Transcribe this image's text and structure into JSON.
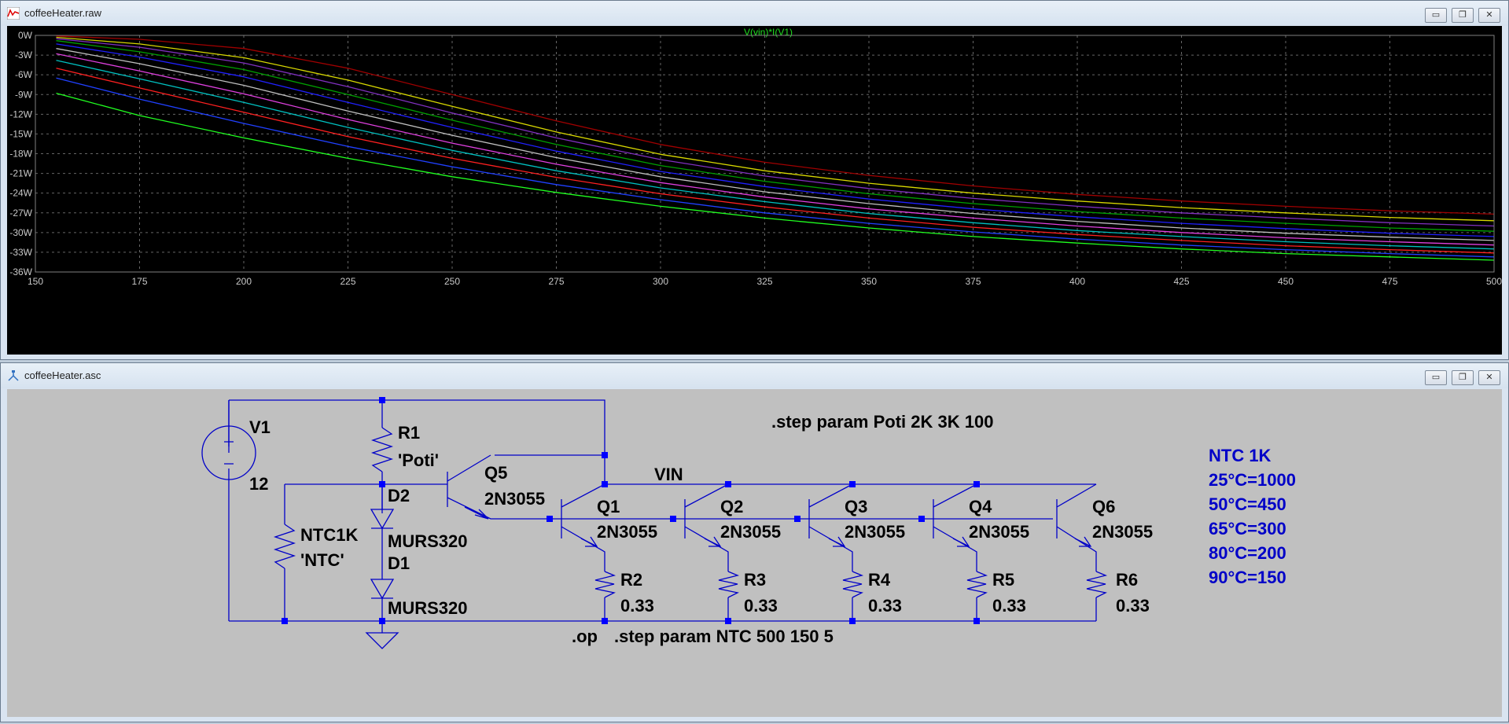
{
  "plot_window": {
    "title": "coffeeHeater.raw",
    "trace_label": "V(vin)*I(V1)",
    "minimize_glyph": "▭",
    "restore_glyph": "❐",
    "close_glyph": "✕"
  },
  "schematic_window": {
    "title": "coffeeHeater.asc",
    "minimize_glyph": "▭",
    "restore_glyph": "❐",
    "close_glyph": "✕"
  },
  "chart_data": {
    "type": "line",
    "title": "V(vin)*I(V1)",
    "xlabel": "",
    "ylabel": "",
    "xlim": [
      150,
      500
    ],
    "ylim": [
      -36,
      0
    ],
    "x_ticks": [
      "150",
      "175",
      "200",
      "225",
      "250",
      "275",
      "300",
      "325",
      "350",
      "375",
      "400",
      "425",
      "450",
      "475",
      "500"
    ],
    "y_ticks": [
      "0W",
      "-3W",
      "-6W",
      "-9W",
      "-12W",
      "-15W",
      "-18W",
      "-21W",
      "-24W",
      "-27W",
      "-30W",
      "-33W",
      "-36W"
    ],
    "grid": true,
    "x": [
      155,
      175,
      200,
      225,
      250,
      275,
      300,
      325,
      350,
      375,
      400,
      425,
      450,
      475,
      500
    ],
    "series": [
      {
        "color": "#a00000",
        "values": [
          -0.1,
          -0.6,
          -2.0,
          -5.0,
          -9.0,
          -13.0,
          -16.6,
          -19.3,
          -21.3,
          -22.9,
          -24.2,
          -25.2,
          -26.0,
          -26.7,
          -27.2
        ]
      },
      {
        "color": "#d8d800",
        "values": [
          -0.3,
          -1.3,
          -3.4,
          -6.8,
          -10.8,
          -14.7,
          -18.1,
          -20.6,
          -22.5,
          -24.0,
          -25.2,
          -26.2,
          -27.0,
          -27.7,
          -28.2
        ]
      },
      {
        "color": "#8030c0",
        "values": [
          -0.5,
          -1.8,
          -4.2,
          -7.8,
          -11.8,
          -15.6,
          -18.9,
          -21.4,
          -23.3,
          -24.8,
          -26.0,
          -27.0,
          -27.8,
          -28.5,
          -29.0
        ]
      },
      {
        "color": "#00a000",
        "values": [
          -0.8,
          -2.5,
          -5.2,
          -9.0,
          -12.9,
          -16.6,
          -19.8,
          -22.2,
          -24.1,
          -25.6,
          -26.8,
          -27.8,
          -28.6,
          -29.3,
          -29.8
        ]
      },
      {
        "color": "#2020ff",
        "values": [
          -1.3,
          -3.3,
          -6.3,
          -10.2,
          -14.0,
          -17.6,
          -20.7,
          -23.0,
          -24.9,
          -26.4,
          -27.6,
          -28.6,
          -29.4,
          -30.1,
          -30.6
        ]
      },
      {
        "color": "#c0c0c0",
        "values": [
          -2.0,
          -4.3,
          -7.6,
          -11.5,
          -15.2,
          -18.6,
          -21.5,
          -23.8,
          -25.6,
          -27.1,
          -28.3,
          -29.3,
          -30.1,
          -30.7,
          -31.2
        ]
      },
      {
        "color": "#e040e0",
        "values": [
          -2.8,
          -5.4,
          -8.9,
          -12.8,
          -16.4,
          -19.6,
          -22.4,
          -24.6,
          -26.4,
          -27.8,
          -29.0,
          -30.0,
          -30.8,
          -31.4,
          -31.9
        ]
      },
      {
        "color": "#00c0c0",
        "values": [
          -3.8,
          -6.6,
          -10.2,
          -14.0,
          -17.5,
          -20.6,
          -23.2,
          -25.3,
          -27.1,
          -28.5,
          -29.7,
          -30.6,
          -31.4,
          -32.0,
          -32.5
        ]
      },
      {
        "color": "#ff2020",
        "values": [
          -5.0,
          -8.0,
          -11.7,
          -15.4,
          -18.7,
          -21.6,
          -24.1,
          -26.1,
          -27.8,
          -29.2,
          -30.3,
          -31.2,
          -32.0,
          -32.6,
          -33.1
        ]
      },
      {
        "color": "#2040ff",
        "values": [
          -6.5,
          -9.7,
          -13.4,
          -16.9,
          -20.0,
          -22.7,
          -25.0,
          -27.0,
          -28.6,
          -29.9,
          -31.0,
          -31.9,
          -32.6,
          -33.2,
          -33.7
        ]
      },
      {
        "color": "#20ff20",
        "values": [
          -8.8,
          -12.2,
          -15.6,
          -18.7,
          -21.5,
          -23.9,
          -26.0,
          -27.8,
          -29.3,
          -30.6,
          -31.6,
          -32.5,
          -33.2,
          -33.7,
          -34.2
        ]
      }
    ]
  },
  "schematic": {
    "labels": {
      "v1": "V1",
      "v1_value": "12",
      "r1": "R1",
      "r1_value": "'Poti'",
      "q5": "Q5",
      "q5_model": "2N3055",
      "d2": "D2",
      "d2_model": "MURS320",
      "d1": "D1",
      "d1_model": "MURS320",
      "ntc": "NTC1K",
      "ntc_value": "'NTC'",
      "vin": "VIN",
      "q1": "Q1",
      "q1_model": "2N3055",
      "q2": "Q2",
      "q2_model": "2N3055",
      "q3": "Q3",
      "q3_model": "2N3055",
      "q4": "Q4",
      "q4_model": "2N3055",
      "q6": "Q6",
      "q6_model": "2N3055",
      "r2": "R2",
      "r2_value": "0.33",
      "r3": "R3",
      "r3_value": "0.33",
      "r4": "R4",
      "r4_value": "0.33",
      "r5": "R5",
      "r5_value": "0.33",
      "r6": "R6",
      "r6_value": "0.33"
    },
    "directive_poti": ".step param Poti 2K 3K 100",
    "directive_op": ".op",
    "directive_ntc": ".step param NTC 500 150 5",
    "ntc_comment": [
      "NTC 1K",
      "25°C=1000",
      "50°C=450",
      "65°C=300",
      "80°C=200",
      "90°C=150"
    ],
    "colors": {
      "wire": "#0000c8",
      "junction": "#0000ff",
      "text": "#000000",
      "comment": "#0000c8"
    }
  }
}
